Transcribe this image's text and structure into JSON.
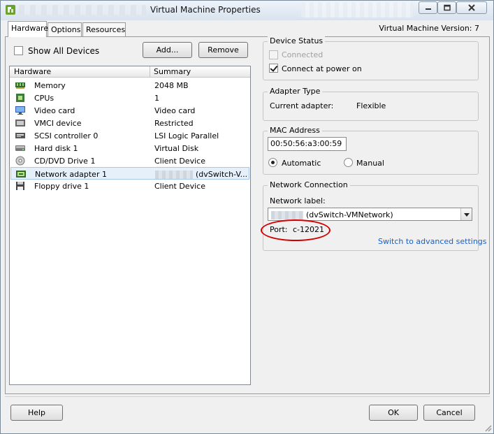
{
  "window": {
    "title": "Virtual Machine Properties",
    "vm_version": "Virtual Machine Version: 7"
  },
  "tabs": [
    {
      "label": "Hardware",
      "active": true
    },
    {
      "label": "Options",
      "active": false
    },
    {
      "label": "Resources",
      "active": false
    }
  ],
  "left": {
    "show_all_devices_label": "Show All Devices",
    "show_all_devices_checked": false,
    "add_label": "Add...",
    "remove_label": "Remove",
    "columns": [
      "Hardware",
      "Summary"
    ],
    "devices": [
      {
        "name": "Memory",
        "summary": "2048 MB",
        "icon": "memory-icon"
      },
      {
        "name": "CPUs",
        "summary": "1",
        "icon": "cpu-icon"
      },
      {
        "name": "Video card",
        "summary": "Video card",
        "icon": "monitor-icon"
      },
      {
        "name": "VMCI device",
        "summary": "Restricted",
        "icon": "vmci-icon"
      },
      {
        "name": "SCSI controller 0",
        "summary": "LSI Logic Parallel",
        "icon": "scsi-icon"
      },
      {
        "name": "Hard disk 1",
        "summary": "Virtual Disk",
        "icon": "hard-disk-icon"
      },
      {
        "name": "CD/DVD Drive 1",
        "summary": "Client Device",
        "icon": "cd-dvd-icon"
      },
      {
        "name": "Network adapter 1",
        "summary": "(dvSwitch-V...",
        "icon": "network-adapter-icon",
        "selected": true
      },
      {
        "name": "Floppy drive 1",
        "summary": "Client Device",
        "icon": "floppy-icon"
      }
    ]
  },
  "device_status": {
    "title": "Device Status",
    "connected_label": "Connected",
    "connected_checked": false,
    "connect_power_label": "Connect at power on",
    "connect_power_checked": true
  },
  "adapter_type": {
    "title": "Adapter Type",
    "current_label": "Current adapter:",
    "current_value": "Flexible"
  },
  "mac_address": {
    "title": "MAC Address",
    "value": "00:50:56:a3:00:59",
    "automatic_label": "Automatic",
    "manual_label": "Manual",
    "selected": "Automatic"
  },
  "network_connection": {
    "title": "Network Connection",
    "network_label": "Network label:",
    "selected_network": "(dvSwitch-VMNetwork)",
    "port_label": "Port:",
    "port_value": "c-12021",
    "advanced_link": "Switch to advanced settings"
  },
  "footer": {
    "help_label": "Help",
    "ok_label": "OK",
    "cancel_label": "Cancel"
  },
  "colors": {
    "accent_link": "#1a5fc7",
    "annotation_red": "#d40000",
    "selection_bg": "#e5f0fb"
  }
}
